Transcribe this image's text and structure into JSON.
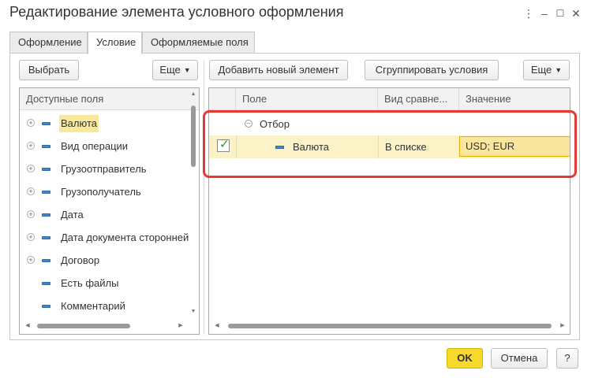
{
  "window": {
    "title": "Редактирование элемента условного оформления",
    "menu_icon": "⋮",
    "minimize_icon": "–",
    "maximize_icon": "☐",
    "close_icon": "✕"
  },
  "tabs": [
    {
      "label": "Оформление",
      "active": false
    },
    {
      "label": "Условие",
      "active": true
    },
    {
      "label": "Оформляемые поля",
      "active": false
    }
  ],
  "left_panel": {
    "select_button": "Выбрать",
    "more_button": "Еще",
    "header": "Доступные поля",
    "fields": [
      {
        "label": "Валюта",
        "expandable": true,
        "selected": true
      },
      {
        "label": "Вид операции",
        "expandable": true,
        "selected": false
      },
      {
        "label": "Грузоотправитель",
        "expandable": true,
        "selected": false
      },
      {
        "label": "Грузополучатель",
        "expandable": true,
        "selected": false
      },
      {
        "label": "Дата",
        "expandable": true,
        "selected": false
      },
      {
        "label": "Дата документа сторонней",
        "expandable": true,
        "selected": false
      },
      {
        "label": "Договор",
        "expandable": true,
        "selected": false
      },
      {
        "label": "Есть файлы",
        "expandable": false,
        "selected": false
      },
      {
        "label": "Комментарий",
        "expandable": false,
        "selected": false
      }
    ]
  },
  "right_panel": {
    "add_button": "Добавить новый элемент",
    "group_button": "Сгруппировать условия",
    "more_button": "Еще",
    "columns": [
      "Поле",
      "Вид сравне...",
      "Значение"
    ],
    "group_row": {
      "label": "Отбор"
    },
    "conditions": [
      {
        "checked": true,
        "field": "Валюта",
        "comparison": "В списке",
        "value": "USD; EUR"
      }
    ]
  },
  "footer": {
    "ok_button": "OK",
    "cancel_button": "Отмена",
    "help_button": "?"
  },
  "colors": {
    "accent_yellow": "#f7d82c",
    "selection_yellow": "#f9e99a",
    "highlight_red": "#e53935",
    "check_green": "#1f9a3b"
  }
}
